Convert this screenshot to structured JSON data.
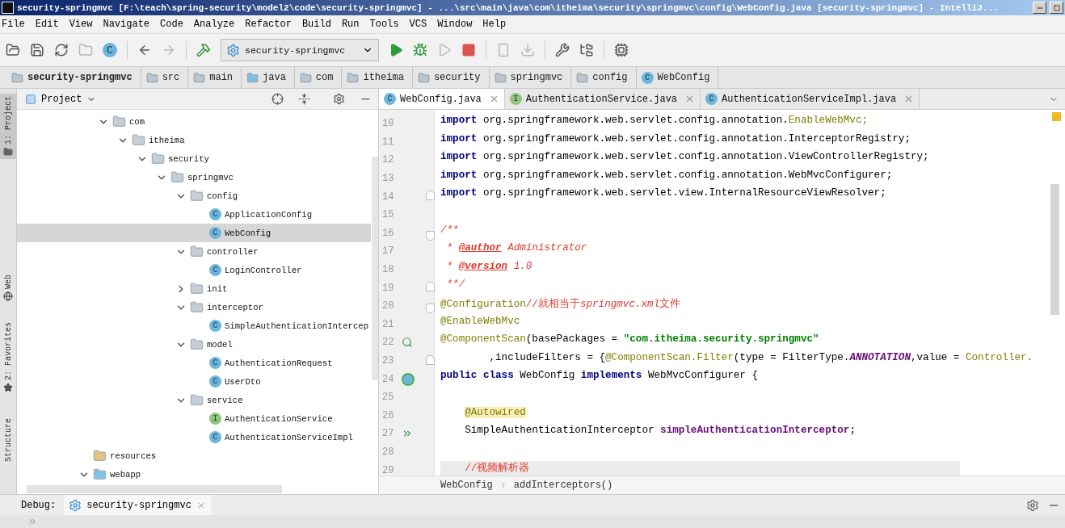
{
  "window": {
    "title": "security-springmvc [F:\\teach\\spring-security\\model2\\code\\security-springmvc] - ...\\src\\main\\java\\com\\itheima\\security\\springmvc\\config\\WebConfig.java [security-springmvc] - IntelliJ..."
  },
  "menu": [
    "File",
    "Edit",
    "View",
    "Navigate",
    "Code",
    "Analyze",
    "Refactor",
    "Build",
    "Run",
    "Tools",
    "VCS",
    "Window",
    "Help"
  ],
  "toolbar": [
    {
      "kind": "open",
      "disabled": false
    },
    {
      "kind": "save",
      "disabled": false
    },
    {
      "kind": "sync",
      "disabled": false
    },
    {
      "kind": "folder",
      "disabled": true
    },
    {
      "kind": "class",
      "letter": "C",
      "disabled": false
    },
    {
      "kind": "sep"
    },
    {
      "kind": "back",
      "disabled": false
    },
    {
      "kind": "forward",
      "disabled": true
    },
    {
      "kind": "sep"
    },
    {
      "kind": "build",
      "disabled": false
    },
    {
      "kind": "config",
      "label": "security-springmvc"
    },
    {
      "kind": "run",
      "disabled": false
    },
    {
      "kind": "debug",
      "disabled": false
    },
    {
      "kind": "coverage",
      "disabled": true
    },
    {
      "kind": "stop",
      "disabled": false
    },
    {
      "kind": "sep"
    },
    {
      "kind": "update",
      "disabled": true
    },
    {
      "kind": "download",
      "disabled": true
    },
    {
      "kind": "sep"
    },
    {
      "kind": "wrench",
      "disabled": false
    },
    {
      "kind": "structure",
      "disabled": false
    },
    {
      "kind": "sep"
    },
    {
      "kind": "sdk",
      "disabled": false
    }
  ],
  "navbar": [
    {
      "label": "security-springmvc",
      "kind": "module"
    },
    {
      "label": "src",
      "kind": "folder"
    },
    {
      "label": "main",
      "kind": "folder"
    },
    {
      "label": "java",
      "kind": "source"
    },
    {
      "label": "com",
      "kind": "package"
    },
    {
      "label": "itheima",
      "kind": "package"
    },
    {
      "label": "security",
      "kind": "package"
    },
    {
      "label": "springmvc",
      "kind": "package"
    },
    {
      "label": "config",
      "kind": "package"
    },
    {
      "label": "WebConfig",
      "kind": "class",
      "letter": "C"
    }
  ],
  "side_stripe": [
    {
      "label": "1: Project",
      "selected": true,
      "kind": "project"
    },
    {
      "label": "Web",
      "selected": false,
      "kind": "web"
    },
    {
      "label": "2: Favorites",
      "selected": false,
      "kind": "favorites"
    },
    {
      "label": "Structure",
      "selected": false,
      "kind": "structure"
    }
  ],
  "project_panel": {
    "title": "Project",
    "nodes": [
      {
        "name": "com",
        "kind": "package",
        "expanded": true,
        "selected": false,
        "children": [
          {
            "name": "itheima",
            "kind": "package",
            "expanded": true,
            "selected": false,
            "children": [
              {
                "name": "security",
                "kind": "package",
                "expanded": true,
                "selected": false,
                "children": [
                  {
                    "name": "springmvc",
                    "kind": "package",
                    "expanded": true,
                    "selected": false,
                    "children": [
                      {
                        "name": "config",
                        "kind": "package",
                        "expanded": true,
                        "selected": false,
                        "children": [
                          {
                            "name": "ApplicationConfig",
                            "kind": "class",
                            "letter": "C",
                            "selected": false
                          },
                          {
                            "name": "WebConfig",
                            "kind": "class",
                            "letter": "C",
                            "selected": true
                          }
                        ]
                      },
                      {
                        "name": "controller",
                        "kind": "package",
                        "expanded": true,
                        "selected": false,
                        "children": [
                          {
                            "name": "LoginController",
                            "kind": "class",
                            "letter": "C",
                            "selected": false
                          }
                        ]
                      },
                      {
                        "name": "init",
                        "kind": "package",
                        "expanded": false,
                        "selected": false
                      },
                      {
                        "name": "interceptor",
                        "kind": "package",
                        "expanded": true,
                        "selected": false,
                        "children": [
                          {
                            "name": "SimpleAuthenticationIntercep",
                            "kind": "class",
                            "letter": "C",
                            "selected": false
                          }
                        ]
                      },
                      {
                        "name": "model",
                        "kind": "package",
                        "expanded": true,
                        "selected": false,
                        "children": [
                          {
                            "name": "AuthenticationRequest",
                            "kind": "class",
                            "letter": "C",
                            "selected": false
                          },
                          {
                            "name": "UserDto",
                            "kind": "class",
                            "letter": "C",
                            "selected": false
                          }
                        ]
                      },
                      {
                        "name": "service",
                        "kind": "package",
                        "expanded": true,
                        "selected": false,
                        "children": [
                          {
                            "name": "AuthenticationService",
                            "kind": "interface",
                            "letter": "I",
                            "selected": false
                          },
                          {
                            "name": "AuthenticationServiceImpl",
                            "kind": "class",
                            "letter": "C",
                            "selected": false
                          }
                        ]
                      }
                    ]
                  }
                ]
              }
            ]
          }
        ]
      }
    ],
    "outer_nodes": [
      {
        "name": "resources",
        "kind": "resources",
        "selected": false
      },
      {
        "name": "webapp",
        "kind": "webfolder",
        "expanded": true,
        "selected": false
      }
    ]
  },
  "tabs": [
    {
      "label": "WebConfig.java",
      "letter": "C",
      "kind": "class",
      "selected": true
    },
    {
      "label": "AuthenticationService.java",
      "letter": "I",
      "kind": "interface",
      "selected": false
    },
    {
      "label": "AuthenticationServiceImpl.java",
      "letter": "C",
      "kind": "class",
      "selected": false
    }
  ],
  "code": [
    {
      "number": "10",
      "tokens": [
        {
          "text": "import",
          "kind": "kw"
        },
        {
          "text": " org.springframework.web.servlet.config.annotation.",
          "kind": "plain"
        },
        {
          "text": "EnableWebMvc;",
          "kind": "unused"
        }
      ]
    },
    {
      "number": "11",
      "tokens": [
        {
          "text": "import",
          "kind": "kw"
        },
        {
          "text": " org.springframework.web.servlet.config.annotation.InterceptorRegistry;",
          "kind": "plain"
        }
      ]
    },
    {
      "number": "12",
      "tokens": [
        {
          "text": "import",
          "kind": "kw"
        },
        {
          "text": " org.springframework.web.servlet.config.annotation.ViewControllerRegistry;",
          "kind": "plain"
        }
      ]
    },
    {
      "number": "13",
      "tokens": [
        {
          "text": "import",
          "kind": "kw"
        },
        {
          "text": " org.springframework.web.servlet.config.annotation.WebMvcConfigurer;",
          "kind": "plain"
        }
      ]
    },
    {
      "number": "14",
      "fold": {
        "kind": "end"
      },
      "tokens": [
        {
          "text": "import",
          "kind": "kw"
        },
        {
          "text": " org.springframework.web.servlet.view.InternalResourceViewResolver;",
          "kind": "plain"
        }
      ]
    },
    {
      "number": "15"
    },
    {
      "number": "16",
      "fold": {
        "kind": "start"
      },
      "tokens": [
        {
          "text": "/**",
          "kind": "doc"
        }
      ]
    },
    {
      "number": "17",
      "tokens": [
        {
          "text": " * ",
          "kind": "doc"
        },
        {
          "text": "@author",
          "kind": "doctag"
        },
        {
          "text": " Administrator",
          "kind": "doc"
        }
      ]
    },
    {
      "number": "18",
      "tokens": [
        {
          "text": " * ",
          "kind": "doc"
        },
        {
          "text": "@version",
          "kind": "doctag"
        },
        {
          "text": " 1.0",
          "kind": "doc"
        }
      ]
    },
    {
      "number": "19",
      "fold": {
        "kind": "end"
      },
      "tokens": [
        {
          "text": " **/",
          "kind": "doc"
        }
      ]
    },
    {
      "number": "20",
      "fold": {
        "kind": "start"
      },
      "tokens": [
        {
          "text": "@Configuration",
          "kind": "ann"
        },
        {
          "text": "//就相当于",
          "kind": "comment"
        },
        {
          "text": "springmvc.xml",
          "kind": "comment-italic"
        },
        {
          "text": "文件",
          "kind": "comment"
        }
      ]
    },
    {
      "number": "21",
      "tokens": [
        {
          "text": "@EnableWebMvc",
          "kind": "ann"
        }
      ]
    },
    {
      "number": "22",
      "gutter": {
        "kind": "search"
      },
      "tokens": [
        {
          "text": "@ComponentScan",
          "kind": "ann"
        },
        {
          "text": "(basePackages = ",
          "kind": "plain"
        },
        {
          "text": "\"com.itheima.security.springmvc\"",
          "kind": "string"
        }
      ]
    },
    {
      "number": "23",
      "fold": {
        "kind": "end"
      },
      "tokens": [
        {
          "text": "        ,includeFilters = {",
          "kind": "plain"
        },
        {
          "text": "@ComponentScan.Filter",
          "kind": "ann"
        },
        {
          "text": "(type = FilterType.",
          "kind": "plain"
        },
        {
          "text": "ANNOTATION",
          "kind": "const"
        },
        {
          "text": ",value = ",
          "kind": "plain"
        },
        {
          "text": "Controller.",
          "kind": "unused"
        }
      ]
    },
    {
      "number": "24",
      "gutter": {
        "kind": "bean"
      },
      "tokens": [
        {
          "text": "public class",
          "kind": "kw"
        },
        {
          "text": " WebConfig ",
          "kind": "plain"
        },
        {
          "text": "implements",
          "kind": "kw"
        },
        {
          "text": " WebMvcConfigurer {",
          "kind": "plain"
        }
      ]
    },
    {
      "number": "25"
    },
    {
      "number": "26",
      "indented": true,
      "tokens": [
        {
          "text": "@Autowired",
          "kind": "ann-hl"
        }
      ]
    },
    {
      "number": "27",
      "gutter": {
        "kind": "inject"
      },
      "tokens": [
        {
          "text": "    SimpleAuthenticationInterceptor ",
          "kind": "plain"
        },
        {
          "text": "simpleAuthenticationInterceptor",
          "kind": "field"
        },
        {
          "text": ";",
          "kind": "plain"
        }
      ]
    },
    {
      "number": "28"
    },
    {
      "number": "29",
      "current": true,
      "indented": true,
      "tokens": [
        {
          "text": "//视频解析器",
          "kind": "comment"
        }
      ]
    }
  ],
  "editor_breadcrumb": [
    "WebConfig",
    "addInterceptors()"
  ],
  "debug_bar": {
    "label": "Debug:",
    "tab": "security-springmvc"
  }
}
